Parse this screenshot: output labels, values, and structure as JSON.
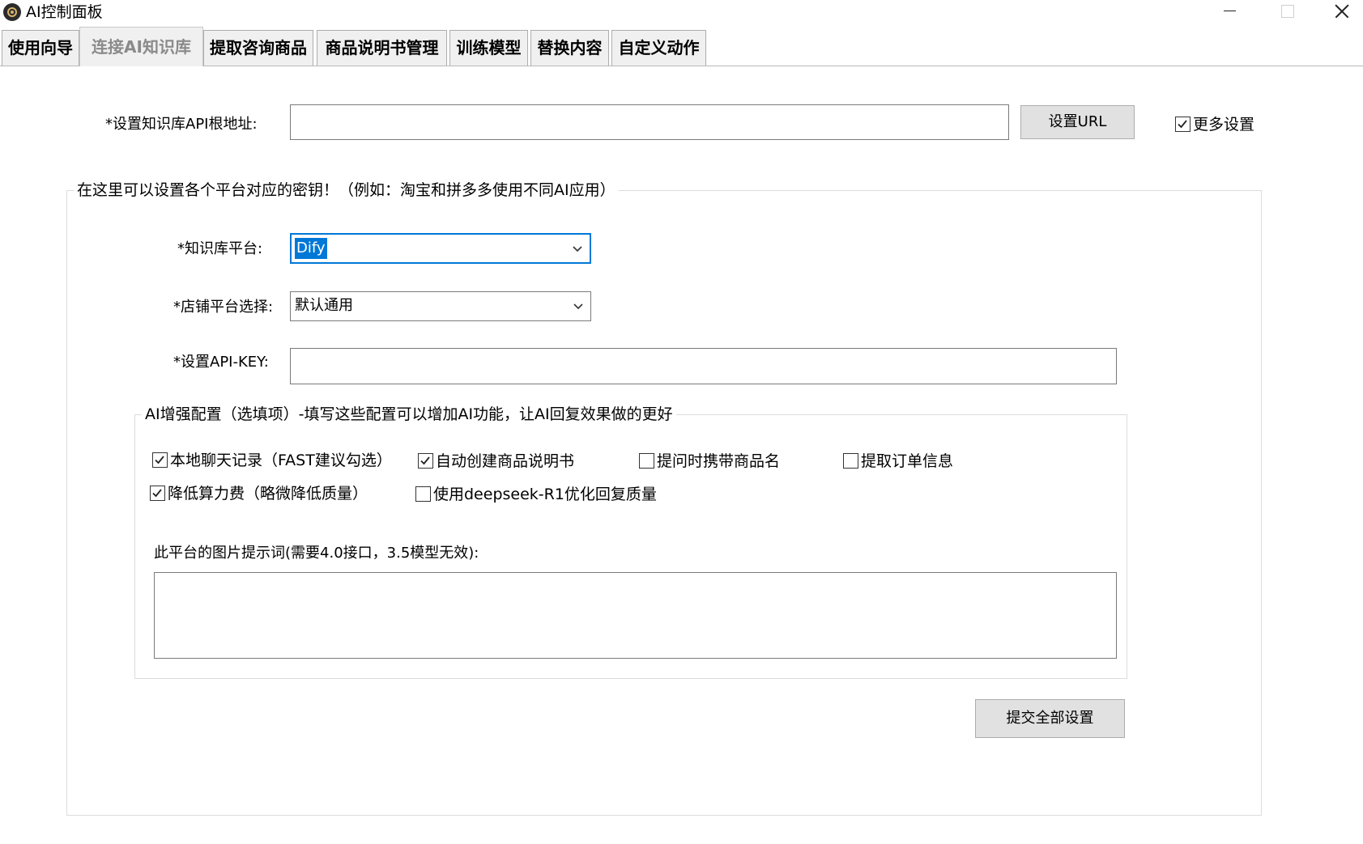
{
  "window": {
    "title": "AI控制面板"
  },
  "tabs": [
    {
      "label": "使用向导",
      "active": false
    },
    {
      "label": "连接AI知识库",
      "active": true
    },
    {
      "label": "提取咨询商品",
      "active": false
    },
    {
      "label": "商品说明书管理",
      "active": false
    },
    {
      "label": "训练模型",
      "active": false
    },
    {
      "label": "替换内容",
      "active": false
    },
    {
      "label": "自定义动作",
      "active": false
    }
  ],
  "api_root": {
    "label": "*设置知识库API根地址:",
    "value": "",
    "button_label": "设置URL",
    "more_settings_label": "更多设置",
    "more_settings_checked": true
  },
  "platform_group": {
    "title": "在这里可以设置各个平台对应的密钥！（例如：淘宝和拼多多使用不同AI应用）",
    "kb_platform": {
      "label": "*知识库平台:",
      "value": "Dify"
    },
    "shop_platform": {
      "label": "*店铺平台选择:",
      "value": "默认通用"
    },
    "api_key": {
      "label": "*设置API-KEY:",
      "value": ""
    },
    "enhance": {
      "title": "AI增强配置（选填项）-填写这些配置可以增加AI功能，让AI回复效果做的更好",
      "options": [
        {
          "label": "本地聊天记录（FAST建议勾选）",
          "checked": true
        },
        {
          "label": "自动创建商品说明书",
          "checked": true
        },
        {
          "label": "提问时携带商品名",
          "checked": false
        },
        {
          "label": "提取订单信息",
          "checked": false
        },
        {
          "label": "降低算力费（略微降低质量）",
          "checked": true
        },
        {
          "label": "使用deepseek-R1优化回复质量",
          "checked": false
        }
      ],
      "image_prompt_label": "此平台的图片提示词(需要4.0接口，3.5模型无效):",
      "image_prompt_value": ""
    },
    "submit_label": "提交全部设置"
  },
  "colors": {
    "focus": "#0078d7",
    "button_face": "#e1e1e1",
    "tab_face": "#f0f0f0"
  }
}
